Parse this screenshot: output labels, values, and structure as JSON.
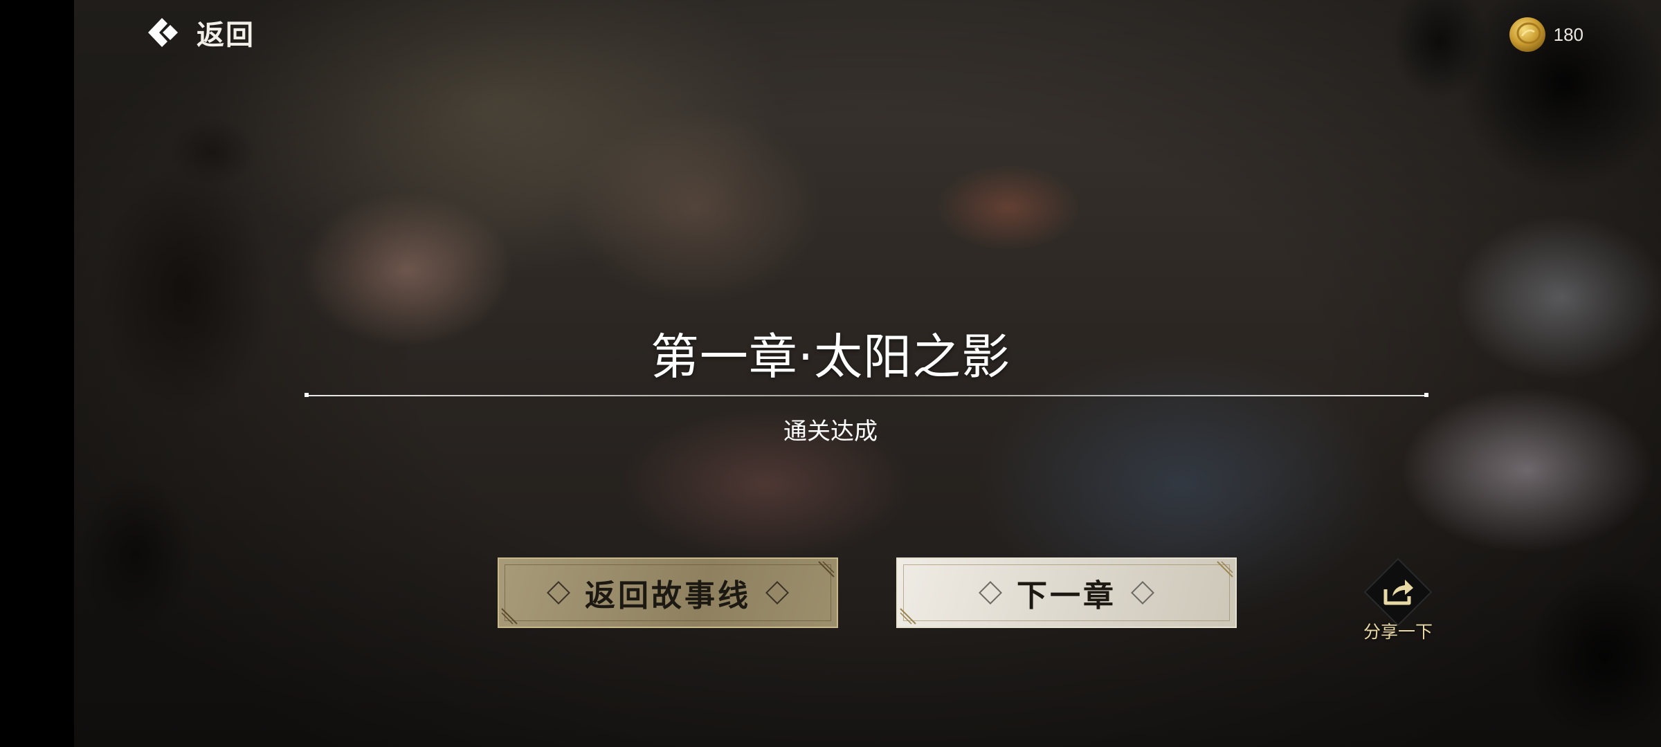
{
  "header": {
    "back_label": "返回",
    "currency_value": "180",
    "currency_icon": "gold-coin-icon"
  },
  "main": {
    "chapter_title": "第一章·太阳之影",
    "status": "通关达成"
  },
  "buttons": {
    "story_label": "返回故事线",
    "next_label": "下一章",
    "share_label": "分享一下"
  },
  "colors": {
    "accent_gold": "#e9d9a4",
    "story_button": "#9c8f6c",
    "next_button": "#e6e2d8"
  }
}
